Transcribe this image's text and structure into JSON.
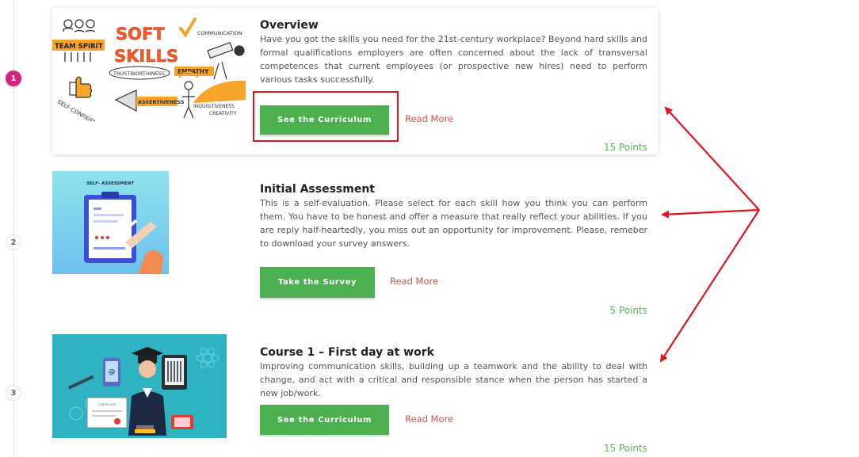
{
  "timeline": {
    "steps": [
      {
        "number": "1",
        "active": true
      },
      {
        "number": "2",
        "active": false
      },
      {
        "number": "3",
        "active": false
      }
    ]
  },
  "items": [
    {
      "title": "Overview",
      "description": "Have you got the skills you need for the 21st-century workplace? Beyond hard skills and formal qualifications employers are often concerned about the lack of transversal competences that current employees (or prospective new hires) need to perform various tasks successfully.",
      "button_label": "See the Curriculum",
      "read_more": "Read More",
      "points": "15 Points",
      "image": {
        "words": {
          "team_spirit": "TEAM SPIRIT",
          "soft": "SOFT",
          "skills": "SKILLS",
          "communication": "COMMUNICATION",
          "trustworthiness": "TRUSTWORTHINESS",
          "empathy": "EMPATHY",
          "self_confidence": "SELF-CONFIDENCE",
          "assertiveness": "ASSERTIVENESS",
          "inquisitiveness": "INQUISITIVENESS",
          "creativity": "CREATIVITY"
        }
      }
    },
    {
      "title": "Initial Assessment",
      "description": "This is a self-evaluation. Please select for each skill how you think you can perform them. You have to be honest and offer a measure that really reflect your abilities. If you are reply half-heartedly, you miss out an opportunity for improvement. Please, remeber to download your survey answers.",
      "button_label": "Take the Survey",
      "read_more": "Read More",
      "points": "5 Points",
      "image": {
        "caption": "SELF- ASSESSMENT"
      }
    },
    {
      "title": "Course 1 – First day at work",
      "description": "Improving communication skills, building up a teamwork and the ability to deal with change, and act with a critical and responsible stance when the person has started a new job/work.",
      "button_label": "See the Curriculum",
      "read_more": "Read More",
      "points": "15 Points",
      "image": {
        "certificate_text": "CERTIFICATE"
      }
    }
  ],
  "colors": {
    "accent_green": "#4caf50",
    "points_green": "#55b95a",
    "read_more_red": "#c9584d",
    "badge_magenta": "#d6247e",
    "annotation_red": "#e3131b"
  }
}
